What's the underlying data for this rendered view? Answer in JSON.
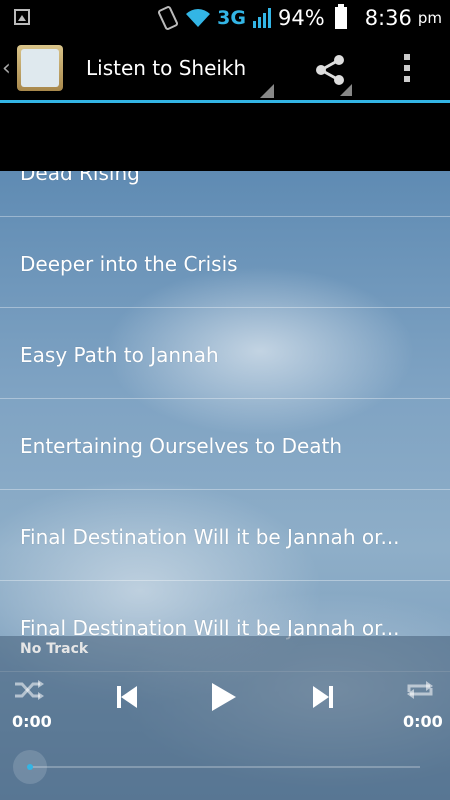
{
  "status_bar": {
    "network": "3G",
    "battery": "94%",
    "time": "8:36",
    "am_pm": "pm"
  },
  "action_bar": {
    "title": "Listen to Sheikh H"
  },
  "tracks": [
    "Dead Rising",
    "Deeper into the Crisis",
    "Easy Path to Jannah",
    "Entertaining Ourselves to Death",
    "Final Destination Will it be Jannah or...",
    "Final Destination Will it be Jannah or..."
  ],
  "player": {
    "now_playing": "No Track",
    "elapsed": "0:00",
    "duration": "0:00",
    "progress": 0
  },
  "colors": {
    "accent": "#33b5e5"
  }
}
